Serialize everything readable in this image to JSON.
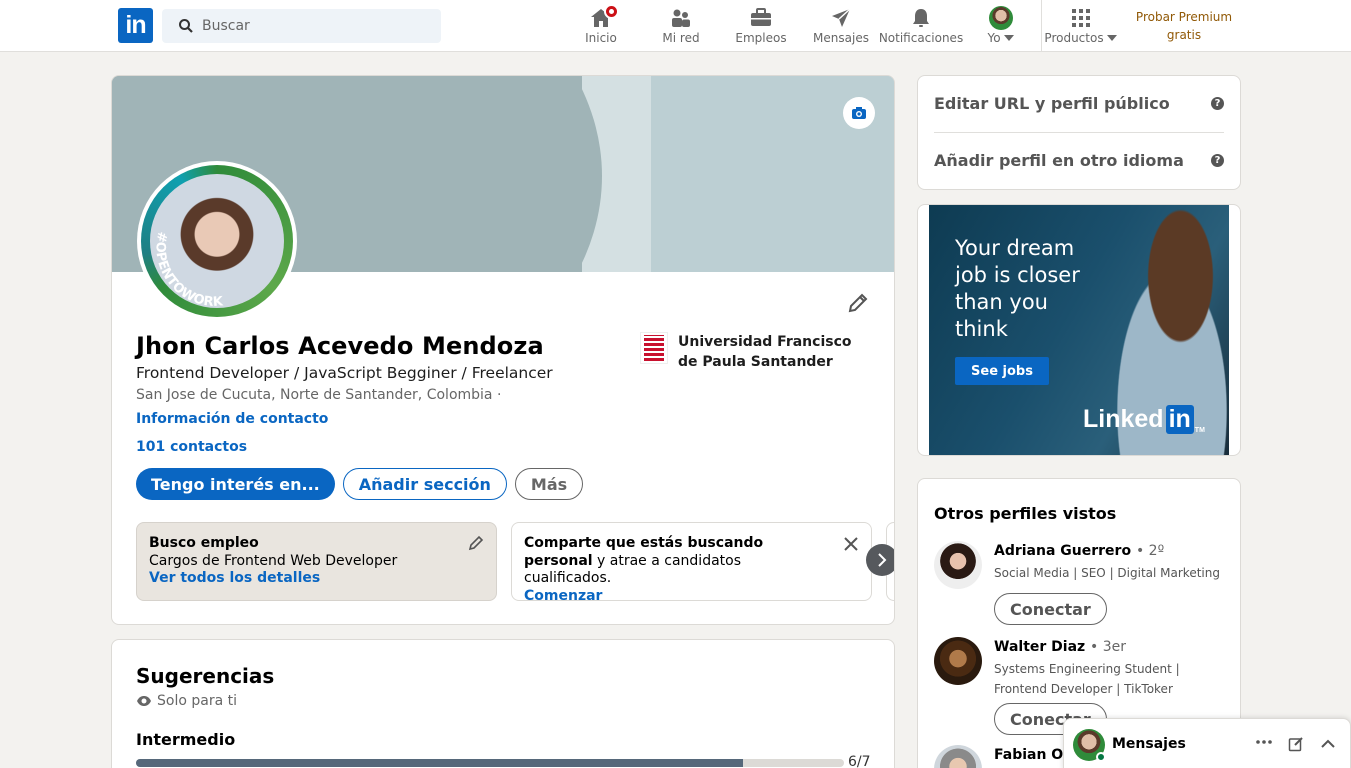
{
  "header": {
    "logo": "in",
    "search_placeholder": "Buscar",
    "nav": [
      {
        "label": "Inicio",
        "icon": "home-icon"
      },
      {
        "label": "Mi red",
        "icon": "network-icon"
      },
      {
        "label": "Empleos",
        "icon": "briefcase-icon"
      },
      {
        "label": "Mensajes",
        "icon": "send-icon"
      },
      {
        "label": "Notificaciones",
        "icon": "bell-icon"
      },
      {
        "label": "Yo",
        "icon": "avatar"
      },
      {
        "label": "Productos",
        "icon": "grid-icon"
      }
    ],
    "premium_line1": "Probar Premium",
    "premium_line2": "gratis"
  },
  "profile": {
    "name": "Jhon Carlos Acevedo Mendoza",
    "headline": "Frontend Developer / JavaScript Begginer / Freelancer",
    "location": "San Jose de Cucuta, Norte de Santander, Colombia ·",
    "contact_info": "Información de contacto",
    "connections": "101 contactos",
    "open_to_work_badge": "#OPENTOWORK",
    "education": "Universidad Francisco de Paula Santander",
    "buttons": {
      "interest": "Tengo interés en...",
      "add_section": "Añadir sección",
      "more": "Más"
    },
    "open_to_work": {
      "title": "Busco empleo",
      "desc": "Cargos de Frontend Web Developer",
      "link": "Ver todos los detalles"
    },
    "hiring": {
      "bold": "Comparte que estás buscando personal",
      "rest": " y atrae a candidatos cualificados.",
      "link": "Comenzar"
    }
  },
  "suggestions": {
    "title": "Sugerencias",
    "private": "Solo para ti",
    "level": "Intermedio",
    "progress_text": "6/7",
    "progress_fraction": 0.857
  },
  "right": {
    "edit_url": "Editar URL y perfil público",
    "add_language": "Añadir perfil en otro idioma",
    "ad": {
      "text_line1": "Your dream",
      "text_line2": "job is closer",
      "text_line3": "than you",
      "text_line4": "think",
      "button": "See jobs",
      "brand": "Linked",
      "brand_in": "in",
      "brand_tm": "TM"
    },
    "people_title": "Otros perfiles vistos",
    "people": [
      {
        "name": "Adriana Guerrero",
        "degree": "• 2º",
        "headline": "Social Media | SEO | Digital Marketing",
        "button": "Conectar"
      },
      {
        "name": "Walter Diaz",
        "degree": "• 3er",
        "headline": "Systems Engineering Student | Frontend Developer | TikToker",
        "button": "Conectar"
      },
      {
        "name": "Fabian Os",
        "degree": "",
        "headline": "",
        "button": ""
      }
    ]
  },
  "messaging": {
    "title": "Mensajes"
  },
  "colors": {
    "brand": "#0a66c2",
    "premium": "#915907",
    "notification_badge": "#cc1016"
  }
}
